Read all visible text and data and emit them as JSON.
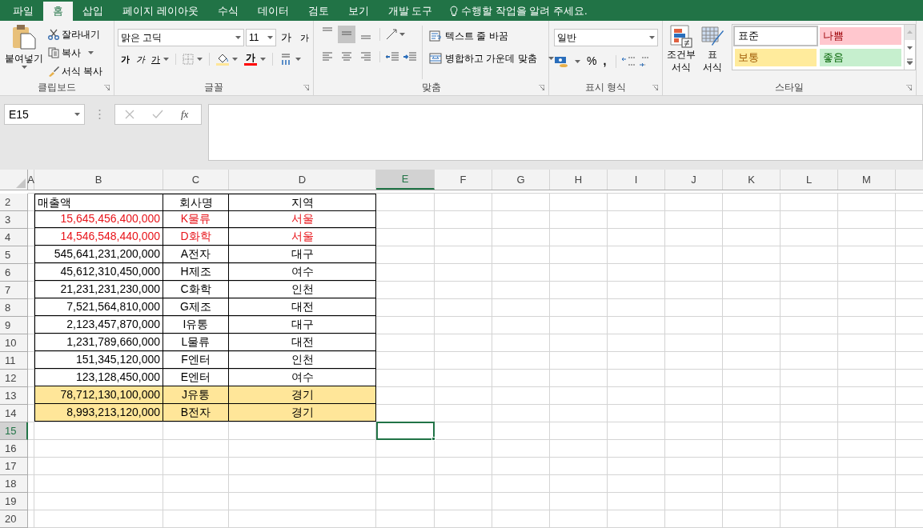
{
  "tabs": [
    {
      "label": "파일",
      "selected": false
    },
    {
      "label": "홈",
      "selected": true
    },
    {
      "label": "삽입",
      "selected": false
    },
    {
      "label": "페이지 레이아웃",
      "selected": false
    },
    {
      "label": "수식",
      "selected": false
    },
    {
      "label": "데이터",
      "selected": false
    },
    {
      "label": "검토",
      "selected": false
    },
    {
      "label": "보기",
      "selected": false
    },
    {
      "label": "개발 도구",
      "selected": false
    }
  ],
  "tell_me": "수행할 작업을 알려 주세요.",
  "clipboard": {
    "label": "클립보드",
    "paste": "붙여넣기",
    "cut": "잘라내기",
    "copy": "복사",
    "format_painter": "서식 복사"
  },
  "font": {
    "label": "글꼴",
    "font_name": "맑은 고딕",
    "font_size": "11",
    "grow": "가",
    "shrink": "가",
    "bold": "가",
    "italic": "가",
    "underline": "가",
    "font_color": "가"
  },
  "alignment": {
    "label": "맞춤",
    "vertical": [
      {
        "kind": "top",
        "selected": false
      },
      {
        "kind": "middle",
        "selected": true
      },
      {
        "kind": "bottom",
        "selected": false
      }
    ],
    "wrap": "텍스트 줄 바꿈",
    "merge": "병합하고 가운데 맞춤"
  },
  "number": {
    "label": "표시 형식",
    "format": "일반",
    "percent": "%",
    "comma": ","
  },
  "styles": {
    "label": "스타일",
    "conditional": "조건부 서식",
    "table": "표 서식",
    "cells": [
      {
        "label": "표준",
        "kind": "normal"
      },
      {
        "label": "나쁨",
        "kind": "bad"
      },
      {
        "label": "보통",
        "kind": "neutral"
      },
      {
        "label": "좋음",
        "kind": "good"
      }
    ]
  },
  "formula_bar": {
    "name_box": "E15",
    "fx": "fx"
  },
  "columns": [
    {
      "label": "A",
      "selected": false
    },
    {
      "label": "B",
      "selected": false
    },
    {
      "label": "C",
      "selected": false
    },
    {
      "label": "D",
      "selected": false
    },
    {
      "label": "E",
      "selected": true
    },
    {
      "label": "F",
      "selected": false
    },
    {
      "label": "G",
      "selected": false
    },
    {
      "label": "H",
      "selected": false
    },
    {
      "label": "I",
      "selected": false
    },
    {
      "label": "J",
      "selected": false
    },
    {
      "label": "K",
      "selected": false
    },
    {
      "label": "L",
      "selected": false
    },
    {
      "label": "M",
      "selected": false
    }
  ],
  "rows": [
    {
      "number": "2",
      "kind": "header",
      "selected": false,
      "b": "매출액",
      "c": "회사명",
      "d": "지역"
    },
    {
      "number": "3",
      "kind": "red",
      "selected": false,
      "b": "15,645,456,400,000",
      "c": "K물류",
      "d": "서울"
    },
    {
      "number": "4",
      "kind": "red",
      "selected": false,
      "b": "14,546,548,440,000",
      "c": "D화학",
      "d": "서울"
    },
    {
      "number": "5",
      "kind": "plain",
      "selected": false,
      "b": "545,641,231,200,000",
      "c": "A전자",
      "d": "대구"
    },
    {
      "number": "6",
      "kind": "plain",
      "selected": false,
      "b": "45,612,310,450,000",
      "c": "H제조",
      "d": "여수"
    },
    {
      "number": "7",
      "kind": "plain",
      "selected": false,
      "b": "21,231,231,230,000",
      "c": "C화학",
      "d": "인천"
    },
    {
      "number": "8",
      "kind": "plain",
      "selected": false,
      "b": "7,521,564,810,000",
      "c": "G제조",
      "d": "대전"
    },
    {
      "number": "9",
      "kind": "plain",
      "selected": false,
      "b": "2,123,457,870,000",
      "c": "I유통",
      "d": "대구"
    },
    {
      "number": "10",
      "kind": "plain",
      "selected": false,
      "b": "1,231,789,660,000",
      "c": "L물류",
      "d": "대전"
    },
    {
      "number": "11",
      "kind": "plain",
      "selected": false,
      "b": "151,345,120,000",
      "c": "F엔터",
      "d": "인천"
    },
    {
      "number": "12",
      "kind": "plain",
      "selected": false,
      "b": "123,128,450,000",
      "c": "E엔터",
      "d": "여수"
    },
    {
      "number": "13",
      "kind": "highlight",
      "selected": false,
      "b": "78,712,130,100,000",
      "c": "J유통",
      "d": "경기"
    },
    {
      "number": "14",
      "kind": "highlight",
      "selected": false,
      "b": "8,993,213,120,000",
      "c": "B전자",
      "d": "경기"
    },
    {
      "number": "15",
      "kind": "empty",
      "selected": true
    },
    {
      "number": "16",
      "kind": "empty",
      "selected": false
    },
    {
      "number": "17",
      "kind": "empty",
      "selected": false
    },
    {
      "number": "18",
      "kind": "empty",
      "selected": false
    },
    {
      "number": "19",
      "kind": "empty",
      "selected": false
    },
    {
      "number": "20",
      "kind": "empty",
      "selected": false
    }
  ]
}
